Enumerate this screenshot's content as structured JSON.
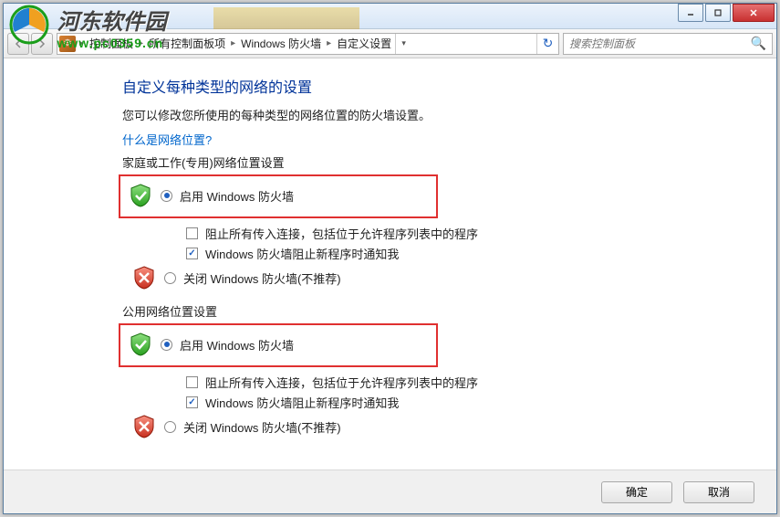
{
  "watermark": {
    "title": "河东软件园",
    "url": "www.pc0359.cn"
  },
  "window": {
    "min": "—",
    "max": "▢",
    "close": "✕"
  },
  "breadcrumb": {
    "segs": [
      "控制面板",
      "所有控制面板项",
      "Windows 防火墙",
      "自定义设置"
    ]
  },
  "search": {
    "placeholder": "搜索控制面板"
  },
  "page": {
    "title": "自定义每种类型的网络的设置",
    "desc": "您可以修改您所使用的每种类型的网络位置的防火墙设置。",
    "link": "什么是网络位置?"
  },
  "sections": {
    "private": {
      "label": "家庭或工作(专用)网络位置设置",
      "enable": "启用 Windows 防火墙",
      "block": "阻止所有传入连接，包括位于允许程序列表中的程序",
      "notify": "Windows 防火墙阻止新程序时通知我",
      "disable": "关闭 Windows 防火墙(不推荐)"
    },
    "public": {
      "label": "公用网络位置设置",
      "enable": "启用 Windows 防火墙",
      "block": "阻止所有传入连接，包括位于允许程序列表中的程序",
      "notify": "Windows 防火墙阻止新程序时通知我",
      "disable": "关闭 Windows 防火墙(不推荐)"
    }
  },
  "footer": {
    "ok": "确定",
    "cancel": "取消"
  }
}
